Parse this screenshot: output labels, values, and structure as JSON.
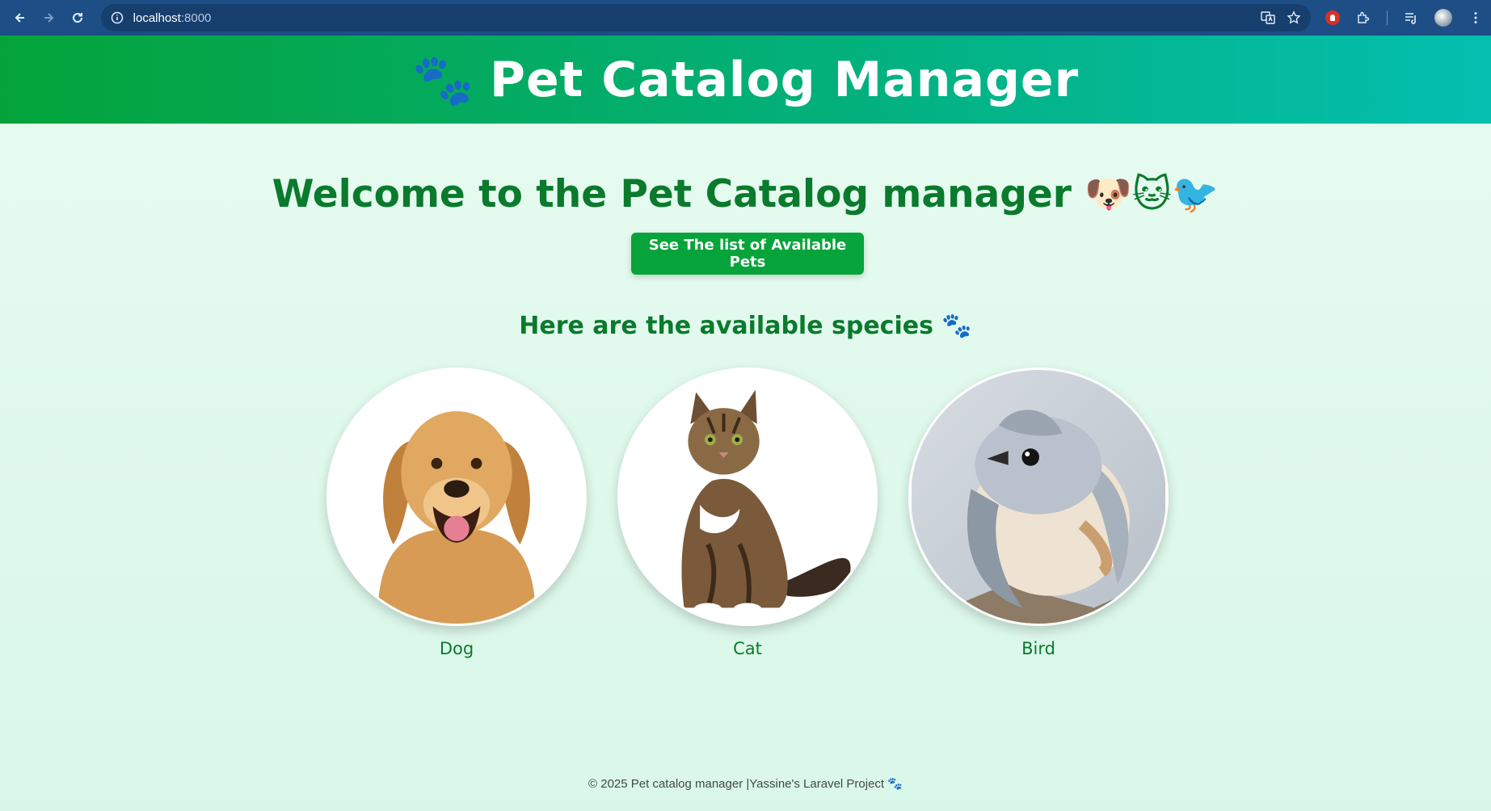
{
  "browser": {
    "url_host": "localhost",
    "url_port": ":8000"
  },
  "header": {
    "icon": "🐾",
    "title": "Pet Catalog Manager"
  },
  "main": {
    "welcome": "Welcome to the Pet Catalog manager 🐶🐱🐦",
    "cta_label": "See The list of Available Pets",
    "species_heading": "Here are the available species",
    "species_heading_icon": "🐾",
    "species": [
      {
        "name": "Dog"
      },
      {
        "name": "Cat"
      },
      {
        "name": "Bird"
      }
    ]
  },
  "footer": {
    "text": "© 2025 Pet catalog manager |Yassine's Laravel Project 🐾"
  },
  "colors": {
    "header_start": "#04a33a",
    "header_end": "#04bfb0",
    "accent_green": "#07a43b",
    "text_green": "#0a7a2c"
  }
}
